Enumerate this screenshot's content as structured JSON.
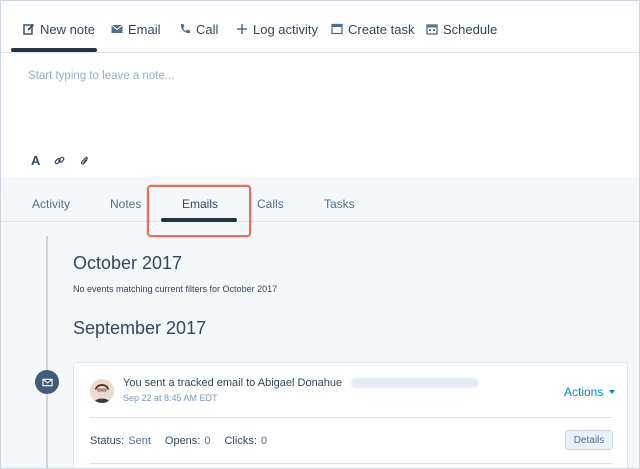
{
  "composer": {
    "tabs": [
      {
        "label": "New note",
        "icon": "pencil-note-icon",
        "active": true
      },
      {
        "label": "Email",
        "icon": "envelope-icon"
      },
      {
        "label": "Call",
        "icon": "phone-icon"
      },
      {
        "label": "Log activity",
        "icon": "plus-icon"
      },
      {
        "label": "Create task",
        "icon": "task-window-icon"
      },
      {
        "label": "Schedule",
        "icon": "calendar-icon"
      }
    ],
    "placeholder": "Start typing to leave a note...",
    "format_text_label": "A"
  },
  "filters": {
    "tabs": [
      "Activity",
      "Notes",
      "Emails",
      "Calls",
      "Tasks"
    ],
    "active": "Emails",
    "highlight_color": "#e2715f"
  },
  "timeline": {
    "months": [
      {
        "title": "October 2017",
        "message": "No events matching current filters for October 2017"
      },
      {
        "title": "September 2017"
      }
    ],
    "email_event": {
      "text_prefix": "You sent a tracked email to",
      "recipient": "Abigael Donahue",
      "date": "Sep 22 at 8:45 AM EDT",
      "actions_label": "Actions",
      "status_label": "Status:",
      "status_value": "Sent",
      "opens_label": "Opens:",
      "opens_value": "0",
      "clicks_label": "Clicks:",
      "clicks_value": "0",
      "details_label": "Details"
    }
  },
  "colors": {
    "accent_link": "#0091ae",
    "dark_navy": "#253342",
    "timeline_dot": "#425b76"
  }
}
